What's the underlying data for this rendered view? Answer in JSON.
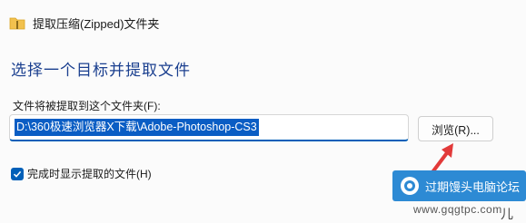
{
  "window": {
    "title": "提取压缩(Zipped)文件夹",
    "icon": "folder-zip-icon"
  },
  "main": {
    "heading": "选择一个目标并提取文件",
    "folder_label": "文件将被提取到这个文件夹(F):",
    "path_value": "D:\\360极速浏览器X下载\\Adobe-Photoshop-CS3",
    "browse_label": "浏览(R)...",
    "checkbox_label": "完成时显示提取的文件(H)",
    "checkbox_checked": true
  },
  "watermark": {
    "text": "过期馒头电脑论坛",
    "url": "www.gqgtpc.com",
    "extra": "儿"
  },
  "colors": {
    "accent": "#005fb8",
    "selection": "#0a5dc4",
    "heading": "#1a3f8f",
    "arrow": "#e23a3a",
    "watermark_bg": "#2d8ad4"
  }
}
